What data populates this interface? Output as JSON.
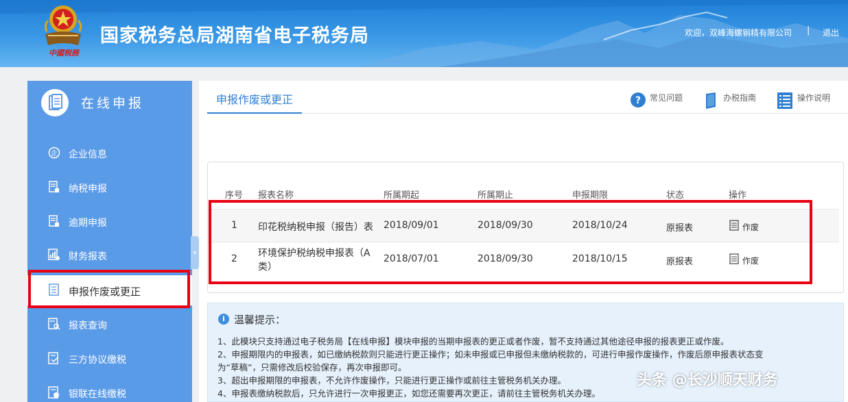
{
  "header": {
    "emblem_caption": "中國税務",
    "site_title": "国家税务总局湖南省电子税务局",
    "welcome_text": "欢迎，双峰海螺钢精有限公司",
    "separator": "|",
    "logout_label": "退出"
  },
  "sidebar": {
    "title": "在线申报",
    "items": [
      {
        "label": "企业信息",
        "icon": "company-icon"
      },
      {
        "label": "纳税申报",
        "icon": "document-icon"
      },
      {
        "label": "逾期申报",
        "icon": "document-icon"
      },
      {
        "label": "财务报表",
        "icon": "report-icon"
      },
      {
        "label": "申报作废或更正",
        "icon": "list-icon",
        "active": true
      },
      {
        "label": "报表查询",
        "icon": "search-report-icon"
      },
      {
        "label": "三方协议缴税",
        "icon": "agreement-icon"
      },
      {
        "label": "银联在线缴税",
        "icon": "payment-icon"
      }
    ],
    "collapse_glyph": "«"
  },
  "main": {
    "tab_label": "申报作废或更正",
    "help_links": [
      {
        "label": "常见问题",
        "icon": "question-icon"
      },
      {
        "label": "办税指南",
        "icon": "book-icon"
      },
      {
        "label": "操作说明",
        "icon": "list-doc-icon"
      }
    ],
    "table": {
      "headers": [
        "序号",
        "报表名称",
        "所属期起",
        "所属期止",
        "申报期限",
        "状态",
        "操作"
      ],
      "rows": [
        {
          "seq": "1",
          "name": "印花税纳税申报（报告）表",
          "start": "2018/09/01",
          "end": "2018/09/30",
          "deadline": "2018/10/24",
          "status": "原报表",
          "action": "作废"
        },
        {
          "seq": "2",
          "name_line1": "环境保护税纳税申报表（A",
          "name_line2": "类）",
          "start": "2018/07/01",
          "end": "2018/09/30",
          "deadline": "2018/10/15",
          "status": "原报表",
          "action": "作废"
        }
      ]
    },
    "tips": {
      "title": "温馨提示：",
      "lines": [
        "1、此模块只支持通过电子税务局【在线申报】模块申报的当期申报表的更正或者作废，暂不支持通过其他途径申报的报表更正或作废。",
        "2、申报期限内的申报表，如已缴纳税款则只能进行更正操作；如未申报或已申报但未缴纳税款的，可进行申报作废操作，作废后原申报表状态变",
        "为“草稿”，只需修改后校验保存，再次申报即可。",
        "3、超出申报期限的申报表，不允许作废操作，只能进行更正操作或前往主管税务机关办理。",
        "4、申报表缴纳税款后，只允许进行一次申报更正，如您还需要再次更正，请前往主管税务机关办理。"
      ]
    }
  },
  "watermark": "头条 @长沙顺天财务",
  "colors": {
    "header_blue": "#2a88dc",
    "sidebar_blue": "#5a9be8",
    "accent_blue": "#2f7fd0",
    "highlight_red": "#e60012",
    "tip_bg": "#e6f1fc"
  }
}
